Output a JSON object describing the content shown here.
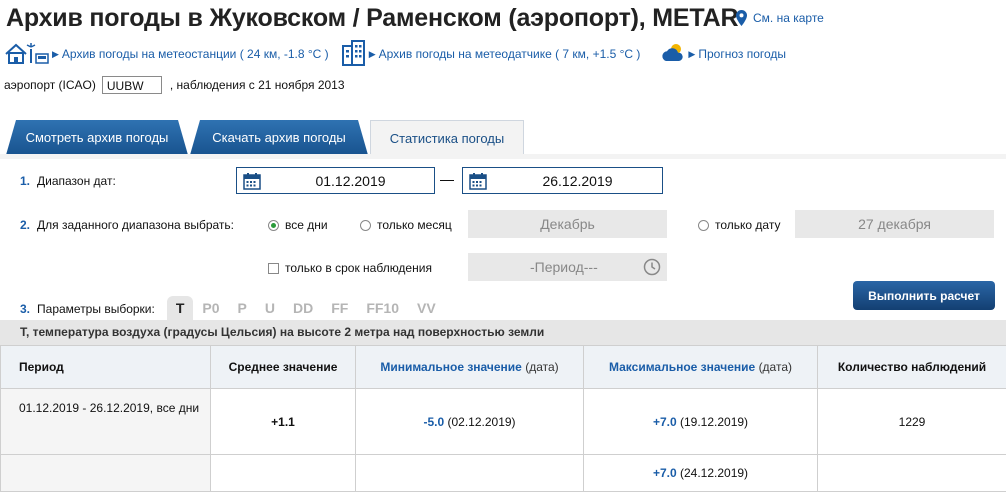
{
  "header": {
    "title": "Архив погоды в Жуковском / Раменском (аэропорт), METAR",
    "map_link": "См. на карте"
  },
  "links": [
    {
      "text": "Архив погоды на метеостанции",
      "detail": "( 24 км, -1.8 °C )"
    },
    {
      "text": "Архив погоды на метеодатчике",
      "detail": "( 7 км, +1.5 °C )"
    },
    {
      "text": "Прогноз погоды",
      "detail": ""
    }
  ],
  "icao": {
    "label": "аэропорт (ICAO)",
    "value": "UUBW",
    "since": ", наблюдения с 21 ноября 2013"
  },
  "tabs": [
    {
      "label": "Смотреть архив погоды",
      "active": false
    },
    {
      "label": "Скачать архив погоды",
      "active": false
    },
    {
      "label": "Статистика погоды",
      "active": true
    }
  ],
  "form": {
    "step1": {
      "num": "1.",
      "label": "Диапазон дат:",
      "from": "01.12.2019",
      "to": "26.12.2019"
    },
    "step2": {
      "num": "2.",
      "label": "Для заданного диапазона выбрать:",
      "opt_all": "все дни",
      "opt_month": "только месяц",
      "month_value": "Декабрь",
      "opt_date": "только дату",
      "date_value": "27 декабря",
      "checkbox": "только в срок наблюдения",
      "period": "-Период---"
    },
    "step3": {
      "num": "3.",
      "label": "Параметры выборки:"
    },
    "params": [
      "T",
      "P0",
      "P",
      "U",
      "DD",
      "FF",
      "FF10",
      "VV"
    ],
    "active_param": "T",
    "run_button": "Выполнить расчет"
  },
  "description": "T, температура воздуха (градусы Цельсия) на высоте 2 метра над поверхностью земли",
  "table": {
    "headers": {
      "period": "Период",
      "avg": "Среднее значение",
      "min": "Минимальное значение",
      "max": "Максимальное значение",
      "date": "(дата)",
      "count": "Количество наблюдений"
    },
    "rows": [
      {
        "period": "01.12.2019 - 26.12.2019, все дни",
        "avg": "+1.1",
        "min": "-5.0",
        "min_date": "(02.12.2019)",
        "max": "+7.0",
        "max_date": "(19.12.2019)",
        "count": "1229"
      },
      {
        "period": "",
        "avg": "",
        "min": "",
        "min_date": "",
        "max": "+7.0",
        "max_date": "(24.12.2019)",
        "count": ""
      }
    ]
  },
  "colors": {
    "link": "#1a5da8",
    "tab_dark": "#1f5e9e",
    "button": "#1d5190",
    "radio_on": "#2a9a3a"
  }
}
